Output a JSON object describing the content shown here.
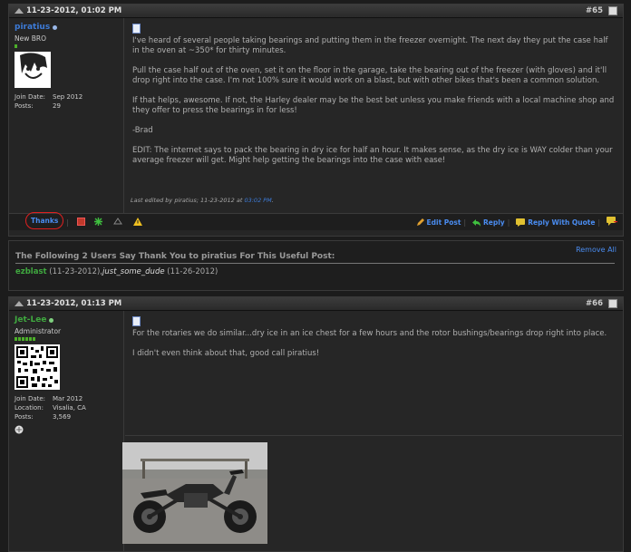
{
  "colors": {
    "accent": "#4a8cf0",
    "username_blue": "#3d7bd8",
    "username_green": "#3fa83f",
    "highlight_red": "#e02020"
  },
  "post1": {
    "date": "11-23-2012, 01:02 PM",
    "number": "#65",
    "user": {
      "name": "piratius",
      "rank": "New BRO",
      "join_label": "Join Date:",
      "join_value": "Sep 2012",
      "posts_label": "Posts:",
      "posts_value": "29"
    },
    "paragraphs": [
      "I've heard of several people taking bearings and putting them in the freezer overnight. The next day they put the case half in the oven at ~350* for thirty minutes.",
      "Pull the case half out of the oven, set it on the floor in the garage, take the bearing out of the freezer (with gloves) and it'll drop right into the case. I'm not 100% sure it would work on a blast, but with other bikes that's been a common solution.",
      "If that helps, awesome. If not, the Harley dealer may be the best bet unless you make friends with a local machine shop and they offer to press the bearings in for less!",
      "-Brad",
      "EDIT: The internet says to pack the bearing in dry ice for half an hour. It makes sense, as the dry ice is WAY colder than your average freezer will get. Might help getting the bearings into the case with ease!"
    ],
    "edited_prefix": "Last edited by piratius; 11-23-2012 at ",
    "edited_time": "03:02 PM",
    "edited_suffix": ".",
    "actions": {
      "thanks": "Thanks",
      "edit": "Edit Post",
      "reply": "Reply",
      "reply_quote": "Reply With Quote"
    }
  },
  "thanks": {
    "title": "The Following 2 Users Say Thank You to piratius For This Useful Post:",
    "remove_all": "Remove All",
    "user1": "ezblast",
    "date1": " (11-23-2012),",
    "user2": "just_some_dude",
    "date2": " (11-26-2012)"
  },
  "post2": {
    "date": "11-23-2012, 01:13 PM",
    "number": "#66",
    "user": {
      "name": "Jet-Lee",
      "rank": "Administrator",
      "join_label": "Join Date:",
      "join_value": "Mar 2012",
      "loc_label": "Location:",
      "loc_value": "Visalia, CA",
      "posts_label": "Posts:",
      "posts_value": "3,569"
    },
    "paragraphs": [
      "For the rotaries we do similar...dry ice in an ice chest for a few hours and the rotor bushings/bearings drop right into place.",
      "I didn't even think about that, good call piratius!"
    ]
  }
}
